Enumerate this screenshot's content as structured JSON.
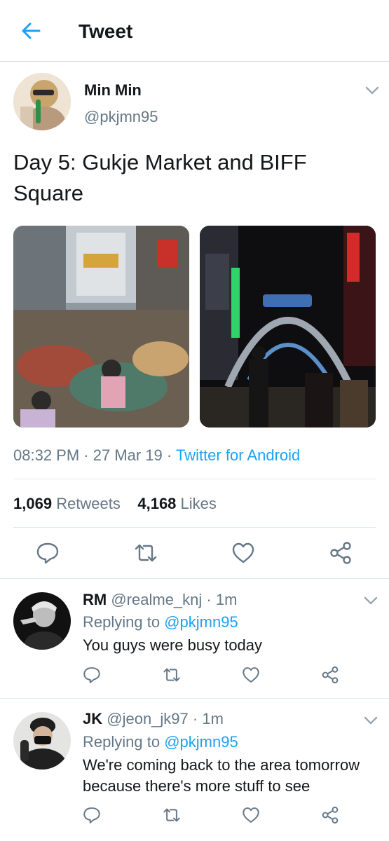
{
  "header": {
    "title": "Tweet"
  },
  "tweet": {
    "name": "Min Min",
    "handle": "@pkjmn95",
    "text": "Day 5: Gukje Market and BIFF Square",
    "time": "08:32 PM",
    "date": "27 Mar 19",
    "client": "Twitter for Android",
    "retweets_count": "1,069",
    "retweets_label": "Retweets",
    "likes_count": "4,168",
    "likes_label": "Likes"
  },
  "replies": [
    {
      "name": "RM",
      "handle": "@realme_knj",
      "time": "1m",
      "replying_prefix": "Replying to",
      "replying_to": "@pkjmn95",
      "text": "You guys were busy today"
    },
    {
      "name": "JK",
      "handle": "@jeon_jk97",
      "time": "1m",
      "replying_prefix": "Replying to",
      "replying_to": "@pkjmn95",
      "text": "We're coming back to the area tomorrow because there's more stuff to see"
    }
  ],
  "colors": {
    "accent": "#1da1f2",
    "muted": "#657786",
    "text": "#14171a",
    "divider": "#e1e8ed"
  },
  "icons": [
    "back-arrow-icon",
    "chevron-down-icon",
    "reply-icon",
    "retweet-icon",
    "like-icon",
    "share-icon"
  ]
}
